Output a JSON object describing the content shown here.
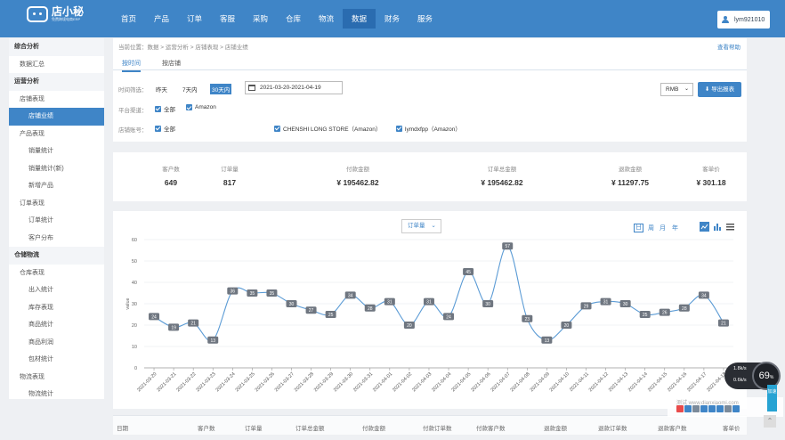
{
  "brand": {
    "name": "店小秘",
    "slogan": "免费跨境电商ERP"
  },
  "nav": {
    "items": [
      "首页",
      "产品",
      "订单",
      "客服",
      "采购",
      "仓库",
      "物流",
      "数据",
      "财务",
      "服务"
    ],
    "active_index": 7
  },
  "user": {
    "name": "lym921010"
  },
  "sidebar": {
    "sections": [
      {
        "title": "综合分析",
        "items": [
          {
            "label": "数据汇总",
            "level": 1
          }
        ]
      },
      {
        "title": "运营分析",
        "items": [
          {
            "label": "店铺表现",
            "level": 1
          },
          {
            "label": "店铺业绩",
            "level": 2,
            "active": true
          },
          {
            "label": "产品表现",
            "level": 1
          },
          {
            "label": "销量统计",
            "level": 2
          },
          {
            "label": "销量统计(新)",
            "level": 2
          },
          {
            "label": "新增产品",
            "level": 2
          },
          {
            "label": "订单表现",
            "level": 1
          },
          {
            "label": "订单统计",
            "level": 2
          },
          {
            "label": "客户分布",
            "level": 2
          }
        ]
      },
      {
        "title": "仓储物流",
        "items": [
          {
            "label": "仓库表现",
            "level": 1
          },
          {
            "label": "出入统计",
            "level": 2
          },
          {
            "label": "库存表现",
            "level": 2
          },
          {
            "label": "商品统计",
            "level": 2
          },
          {
            "label": "商品利润",
            "level": 2
          },
          {
            "label": "包材统计",
            "level": 2
          },
          {
            "label": "物流表现",
            "level": 1
          },
          {
            "label": "物流统计",
            "level": 2
          }
        ]
      }
    ]
  },
  "breadcrumb": "当前位置：数据 > 运营分析 > 店铺表现 > 店铺业绩",
  "help_label": "查看帮助",
  "tabs": [
    "按时间",
    "按店铺"
  ],
  "filters": {
    "time_label": "时间筛选：",
    "time_opts": [
      "昨天",
      "7天内",
      "30天内"
    ],
    "time_active": "30天内",
    "date_range": "2021-03-20-2021-04-19",
    "platform_label": "平台渠道：",
    "platform_opts": [
      "全部",
      "Amazon"
    ],
    "account_label": "店铺账号：",
    "account_opts": [
      "全部",
      "CHENSHI LONG STORE（Amazon）",
      "lymdxfpp（Amazon）"
    ],
    "currency": "RMB",
    "export_label": "导出报表"
  },
  "stats": [
    {
      "label": "客户数",
      "value": "649"
    },
    {
      "label": "订单量",
      "value": "817"
    },
    {
      "label": "付款金额",
      "value": "¥ 195462.82"
    },
    {
      "label": "订单总金额",
      "value": "¥ 195462.82"
    },
    {
      "label": "退款金额",
      "value": "¥ 11297.75"
    },
    {
      "label": "客单价",
      "value": "¥ 301.18"
    }
  ],
  "chart_controls": {
    "metric": "订单量",
    "periods": [
      "日",
      "周",
      "月",
      "年"
    ]
  },
  "chart_data": {
    "type": "line",
    "title": "",
    "xlabel": "",
    "ylabel": "value",
    "ylim": [
      0,
      60
    ],
    "yticks": [
      0,
      10,
      20,
      30,
      40,
      50,
      60
    ],
    "x": [
      "2021-03-20",
      "2021-03-21",
      "2021-03-22",
      "2021-03-23",
      "2021-03-24",
      "2021-03-25",
      "2021-03-26",
      "2021-03-27",
      "2021-03-28",
      "2021-03-29",
      "2021-03-30",
      "2021-03-31",
      "2021-04-01",
      "2021-04-02",
      "2021-04-03",
      "2021-04-04",
      "2021-04-05",
      "2021-04-06",
      "2021-04-07",
      "2021-04-08",
      "2021-04-09",
      "2021-04-10",
      "2021-04-11",
      "2021-04-12",
      "2021-04-13",
      "2021-04-14",
      "2021-04-15",
      "2021-04-16",
      "2021-04-17",
      "2021-04-18"
    ],
    "series": [
      {
        "values": [
          24,
          19,
          21,
          13,
          36,
          35,
          35,
          30,
          27,
          25,
          34,
          28,
          31,
          20,
          31,
          24,
          45,
          30,
          57,
          23,
          13,
          20,
          29,
          31,
          30,
          25,
          26,
          28,
          34,
          21
        ]
      }
    ],
    "color": "#5b9bd5"
  },
  "table": {
    "headers": [
      "日期",
      "客户数",
      "订单量",
      "订单总金额",
      "付款金额",
      "付款订单数",
      "付款客户数",
      "退款金额",
      "退款订单数",
      "退款客户数",
      "客单价"
    ]
  },
  "overlays": {
    "speed_up": "1.8k/s",
    "speed_down": "0.6k/s",
    "gauge": "69",
    "gauge_unit": "%",
    "side_tag": "加速",
    "watermark": "测试 www.dianxiaomi.com"
  }
}
